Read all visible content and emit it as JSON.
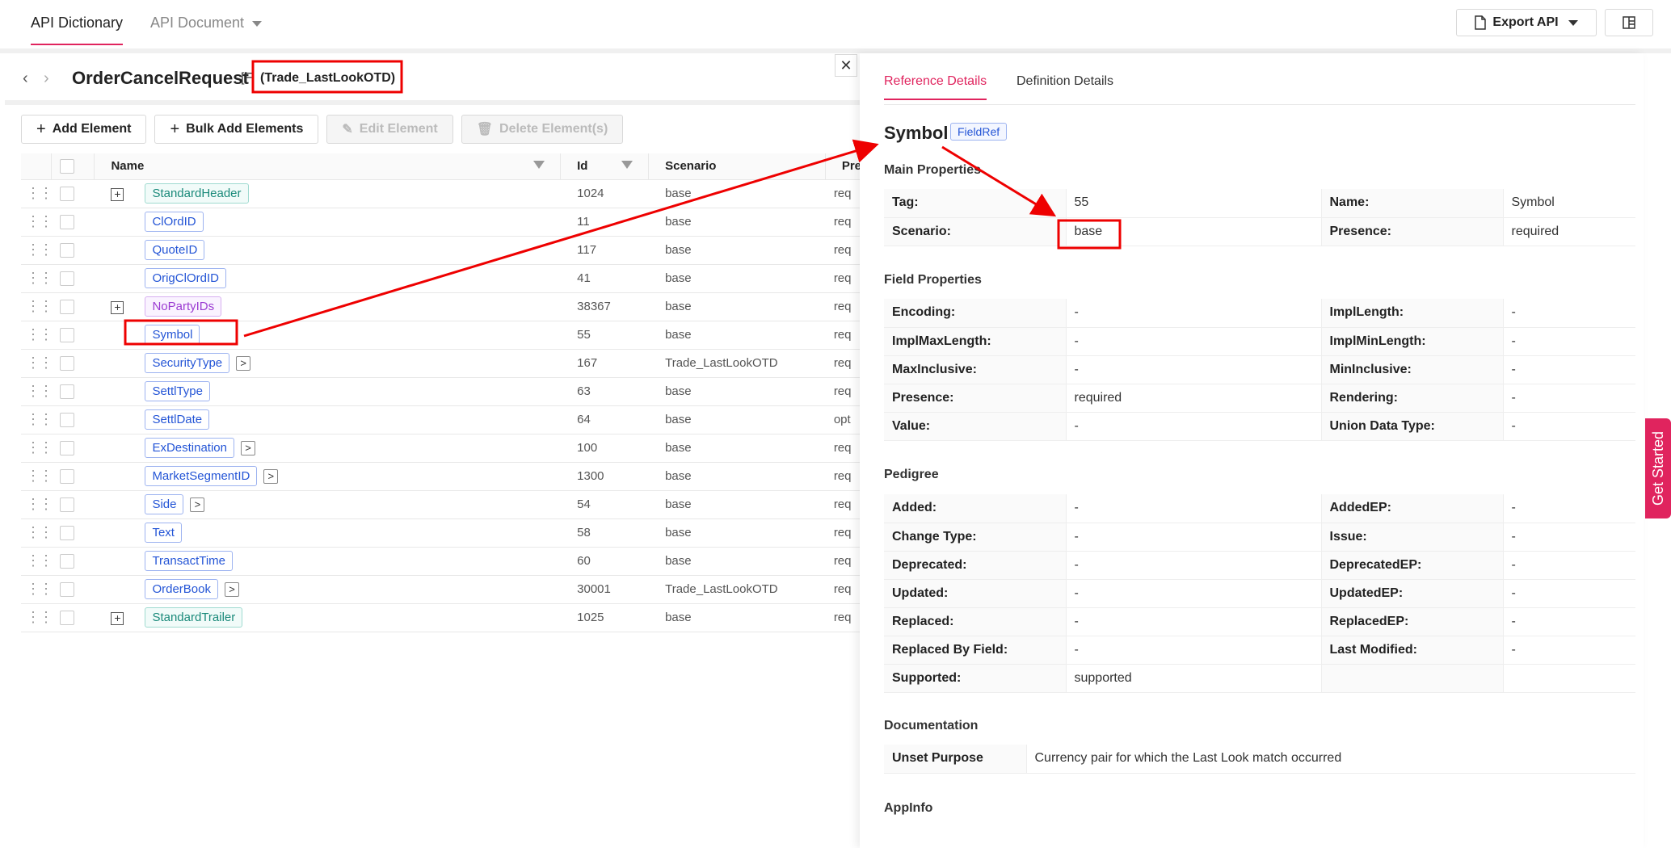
{
  "topbar": {
    "tab_dictionary": "API Dictionary",
    "tab_document": "API Document",
    "export_label": "Export API"
  },
  "left": {
    "title": "OrderCancelRequest",
    "title_suffix": "[F",
    "scenario": "(Trade_LastLookOTD)",
    "actions": {
      "add": "Add Element",
      "bulk_add": "Bulk Add Elements",
      "edit": "Edit Element",
      "delete": "Delete Element(s)"
    },
    "columns": {
      "name": "Name",
      "id": "Id",
      "scenario": "Scenario",
      "presence": "Pre"
    },
    "rows": [
      {
        "name": "StandardHeader",
        "id": "1024",
        "scenario": "base",
        "presence": "req",
        "kind": "comp",
        "expand": true,
        "nav": false
      },
      {
        "name": "ClOrdID",
        "id": "11",
        "scenario": "base",
        "presence": "req",
        "kind": "field",
        "expand": false,
        "nav": false
      },
      {
        "name": "QuoteID",
        "id": "117",
        "scenario": "base",
        "presence": "req",
        "kind": "field",
        "expand": false,
        "nav": false
      },
      {
        "name": "OrigClOrdID",
        "id": "41",
        "scenario": "base",
        "presence": "req",
        "kind": "field",
        "expand": false,
        "nav": false
      },
      {
        "name": "NoPartyIDs",
        "id": "38367",
        "scenario": "base",
        "presence": "req",
        "kind": "group",
        "expand": true,
        "nav": false
      },
      {
        "name": "Symbol",
        "id": "55",
        "scenario": "base",
        "presence": "req",
        "kind": "field",
        "expand": false,
        "nav": false,
        "selected": true
      },
      {
        "name": "SecurityType",
        "id": "167",
        "scenario": "Trade_LastLookOTD",
        "presence": "req",
        "kind": "field",
        "expand": false,
        "nav": true
      },
      {
        "name": "SettlType",
        "id": "63",
        "scenario": "base",
        "presence": "req",
        "kind": "field",
        "expand": false,
        "nav": false
      },
      {
        "name": "SettlDate",
        "id": "64",
        "scenario": "base",
        "presence": "opt",
        "kind": "field",
        "expand": false,
        "nav": false
      },
      {
        "name": "ExDestination",
        "id": "100",
        "scenario": "base",
        "presence": "req",
        "kind": "field",
        "expand": false,
        "nav": true
      },
      {
        "name": "MarketSegmentID",
        "id": "1300",
        "scenario": "base",
        "presence": "req",
        "kind": "field",
        "expand": false,
        "nav": true
      },
      {
        "name": "Side",
        "id": "54",
        "scenario": "base",
        "presence": "req",
        "kind": "field",
        "expand": false,
        "nav": true
      },
      {
        "name": "Text",
        "id": "58",
        "scenario": "base",
        "presence": "req",
        "kind": "field",
        "expand": false,
        "nav": false
      },
      {
        "name": "TransactTime",
        "id": "60",
        "scenario": "base",
        "presence": "req",
        "kind": "field",
        "expand": false,
        "nav": false
      },
      {
        "name": "OrderBook",
        "id": "30001",
        "scenario": "Trade_LastLookOTD",
        "presence": "req",
        "kind": "field",
        "expand": false,
        "nav": true
      },
      {
        "name": "StandardTrailer",
        "id": "1025",
        "scenario": "base",
        "presence": "req",
        "kind": "comp",
        "expand": true,
        "nav": false
      }
    ]
  },
  "right": {
    "tab_reference": "Reference Details",
    "tab_definition": "Definition Details",
    "title": "Symbol",
    "badge": "FieldRef",
    "main_title": "Main Properties",
    "main": [
      [
        "Tag:",
        "55",
        "Name:",
        "Symbol"
      ],
      [
        "Scenario:",
        "base",
        "Presence:",
        "required"
      ]
    ],
    "field_title": "Field Properties",
    "field": [
      [
        "Encoding:",
        "-",
        "ImplLength:",
        "-"
      ],
      [
        "ImplMaxLength:",
        "-",
        "ImplMinLength:",
        "-"
      ],
      [
        "MaxInclusive:",
        "-",
        "MinInclusive:",
        "-"
      ],
      [
        "Presence:",
        "required",
        "Rendering:",
        "-"
      ],
      [
        "Value:",
        "-",
        "Union Data Type:",
        "-"
      ]
    ],
    "pedigree_title": "Pedigree",
    "pedigree": [
      [
        "Added:",
        "-",
        "AddedEP:",
        "-"
      ],
      [
        "Change Type:",
        "-",
        "Issue:",
        "-"
      ],
      [
        "Deprecated:",
        "-",
        "DeprecatedEP:",
        "-"
      ],
      [
        "Updated:",
        "-",
        "UpdatedEP:",
        "-"
      ],
      [
        "Replaced:",
        "-",
        "ReplacedEP:",
        "-"
      ],
      [
        "Replaced By Field:",
        "-",
        "Last Modified:",
        "-"
      ],
      [
        "Supported:",
        "supported",
        "",
        ""
      ]
    ],
    "doc_title": "Documentation",
    "doc_key": "Unset Purpose",
    "doc_value": "Currency pair for which the Last Look match occurred",
    "appinfo_title": "AppInfo"
  },
  "get_started": "Get Started",
  "colors": {
    "accent": "#e0245e",
    "annotation": "#e00000",
    "field": "#2455d6",
    "component": "#1a8a7a",
    "group": "#9b3bd2"
  }
}
